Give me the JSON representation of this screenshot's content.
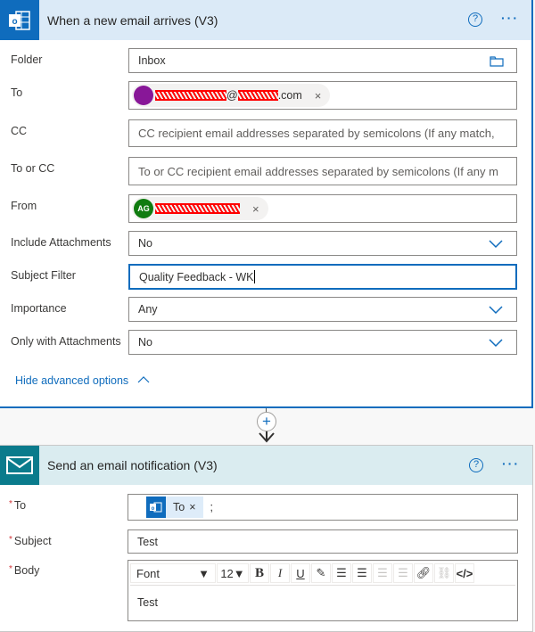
{
  "trigger": {
    "title": "When a new email arrives (V3)",
    "help_icon": "?",
    "more_icon": "···",
    "fields": [
      {
        "label": "Folder",
        "value": "Inbox"
      },
      {
        "label": "To",
        "chip_email_suffix": "@",
        "chip_email_domain": ".com"
      },
      {
        "label": "CC",
        "placeholder": "CC recipient email addresses separated by semicolons (If any match,"
      },
      {
        "label": "To or CC",
        "placeholder": "To or CC recipient email addresses separated by semicolons (If any m"
      },
      {
        "label": "From",
        "chip_initials": "AG"
      },
      {
        "label": "Include Attachments",
        "value": "No"
      },
      {
        "label": "Subject Filter",
        "value": "Quality Feedback - WK"
      },
      {
        "label": "Importance",
        "value": "Any"
      },
      {
        "label": "Only with Attachments",
        "value": "No"
      }
    ],
    "hide_advanced": "Hide advanced options",
    "remove_icon": "×"
  },
  "connector": {
    "plus": "+"
  },
  "action": {
    "title": "Send an email notification (V3)",
    "help_icon": "?",
    "more_icon": "···",
    "to_label": "To",
    "to_chip": "To",
    "to_sep": ";",
    "subject_label": "Subject",
    "subject_value": "Test",
    "body_label": "Body",
    "required": "*",
    "toolbar": {
      "font": "Font",
      "size": "12",
      "bold": "B",
      "italic": "I",
      "underline": "U",
      "code": "</>"
    },
    "body_value": "Test"
  },
  "colors": {
    "accent": "#0f6cbd",
    "trigger_header": "#dbeaf7",
    "action_header": "#daecf0",
    "action_icon": "#0a7b8c",
    "to_avatar": "#881798",
    "from_avatar": "#107c10"
  }
}
